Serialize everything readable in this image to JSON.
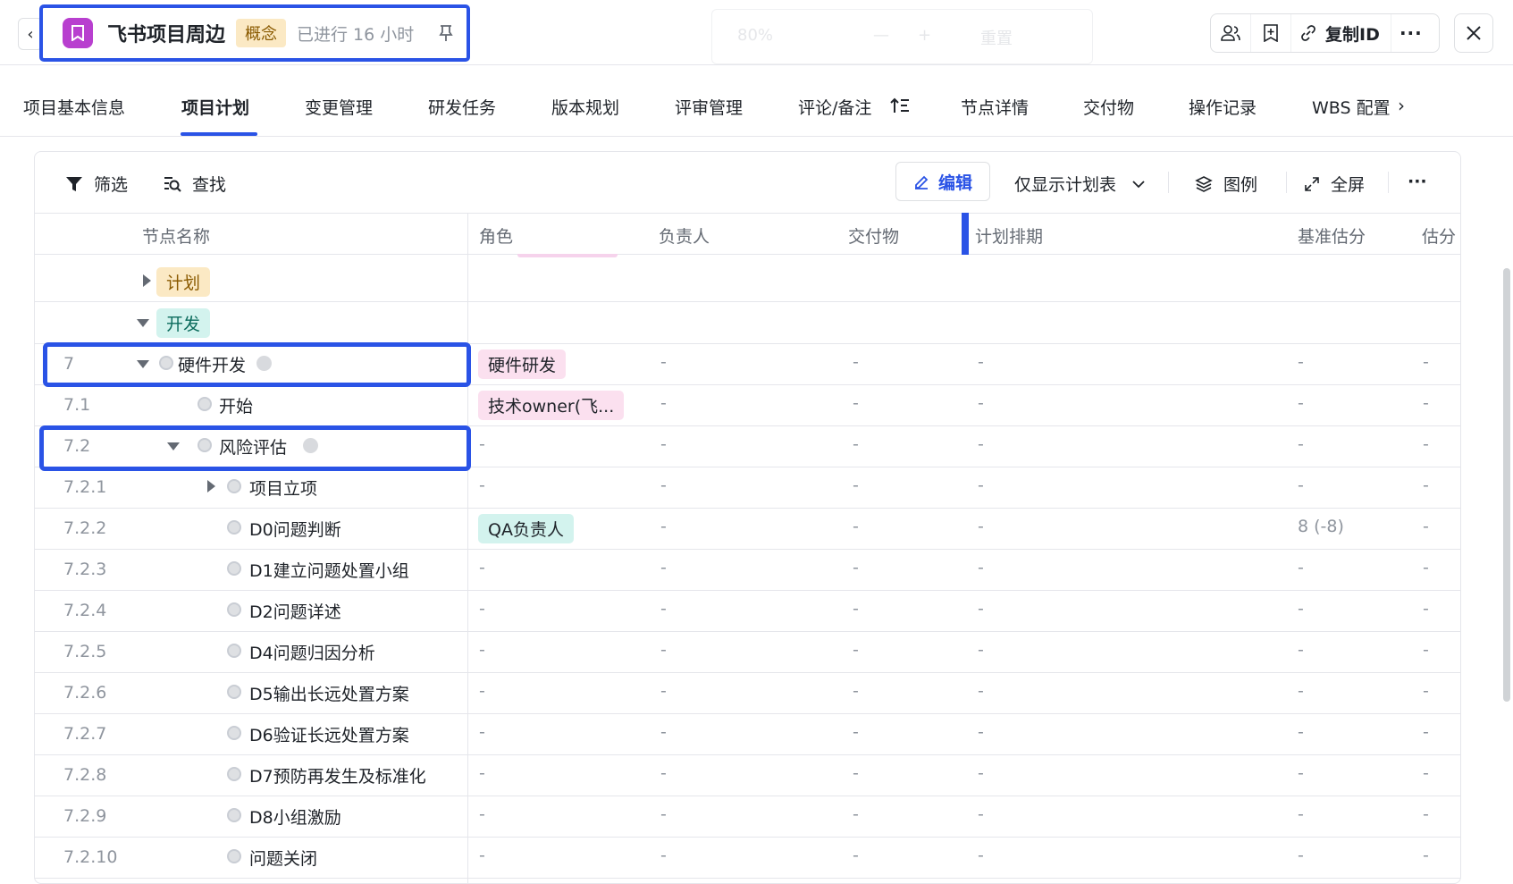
{
  "header": {
    "back_label": "‹",
    "project_title": "飞书项目周边",
    "stage": "概念",
    "elapsed": "已进行 16 小时",
    "ghost_zoom": "80%",
    "ghost_reset": "重置",
    "copy_id": "复制ID",
    "more": "···",
    "close": "✕"
  },
  "tabs": [
    {
      "label": "项目基本信息"
    },
    {
      "label": "项目计划",
      "active": true
    },
    {
      "label": "变更管理"
    },
    {
      "label": "研发任务"
    },
    {
      "label": "版本规划"
    },
    {
      "label": "评审管理"
    },
    {
      "label": "评论/备注"
    },
    {
      "label": "节点详情"
    },
    {
      "label": "交付物"
    },
    {
      "label": "操作记录"
    },
    {
      "label": "WBS 配置"
    }
  ],
  "tab_more": "›",
  "toolbar": {
    "filter": "筛选",
    "find": "查找",
    "edit": "编辑",
    "view_mode": "仅显示计划表",
    "legend": "图例",
    "fullscreen": "全屏",
    "more": "···"
  },
  "columns": {
    "node_name": "节点名称",
    "role": "角色",
    "owner": "负责人",
    "deliverable": "交付物",
    "schedule": "计划排期",
    "baseline_score": "基准估分",
    "score": "估分"
  },
  "groups": {
    "plan": "计划",
    "dev": "开发"
  },
  "rows": [
    {
      "num": "7",
      "name": "硬件开发",
      "role": "硬件研发",
      "owner": "-",
      "deliverable": "-",
      "schedule": "-",
      "baseline": "-",
      "score": "-"
    },
    {
      "num": "7.1",
      "name": "开始",
      "role": "技术owner(飞...",
      "owner": "-",
      "deliverable": "-",
      "schedule": "-",
      "baseline": "-",
      "score": "-"
    },
    {
      "num": "7.2",
      "name": "风险评估",
      "role": "-",
      "owner": "-",
      "deliverable": "-",
      "schedule": "-",
      "baseline": "-",
      "score": "-"
    },
    {
      "num": "7.2.1",
      "name": "项目立项",
      "role": "-",
      "owner": "-",
      "deliverable": "-",
      "schedule": "-",
      "baseline": "-",
      "score": "-"
    },
    {
      "num": "7.2.2",
      "name": "D0问题判断",
      "role": "QA负责人",
      "owner": "-",
      "deliverable": "-",
      "schedule": "-",
      "baseline": "8 (-8)",
      "score": "-"
    },
    {
      "num": "7.2.3",
      "name": "D1建立问题处置小组",
      "role": "-",
      "owner": "-",
      "deliverable": "-",
      "schedule": "-",
      "baseline": "-",
      "score": "-"
    },
    {
      "num": "7.2.4",
      "name": "D2问题详述",
      "role": "-",
      "owner": "-",
      "deliverable": "-",
      "schedule": "-",
      "baseline": "-",
      "score": "-"
    },
    {
      "num": "7.2.5",
      "name": "D4问题归因分析",
      "role": "-",
      "owner": "-",
      "deliverable": "-",
      "schedule": "-",
      "baseline": "-",
      "score": "-"
    },
    {
      "num": "7.2.6",
      "name": "D5输出长远处置方案",
      "role": "-",
      "owner": "-",
      "deliverable": "-",
      "schedule": "-",
      "baseline": "-",
      "score": "-"
    },
    {
      "num": "7.2.7",
      "name": "D6验证长远处置方案",
      "role": "-",
      "owner": "-",
      "deliverable": "-",
      "schedule": "-",
      "baseline": "-",
      "score": "-"
    },
    {
      "num": "7.2.8",
      "name": "D7预防再发生及标准化",
      "role": "-",
      "owner": "-",
      "deliverable": "-",
      "schedule": "-",
      "baseline": "-",
      "score": "-"
    },
    {
      "num": "7.2.9",
      "name": "D8小组激励",
      "role": "-",
      "owner": "-",
      "deliverable": "-",
      "schedule": "-",
      "baseline": "-",
      "score": "-"
    },
    {
      "num": "7.2.10",
      "name": "问题关闭",
      "role": "-",
      "owner": "-",
      "deliverable": "-",
      "schedule": "-",
      "baseline": "-",
      "score": "-"
    }
  ],
  "colors": {
    "accent": "#2a53e6",
    "project_icon": "#b83fcf",
    "stage_badge_bg": "#fbe9c4",
    "tag_plan_bg": "#fbe9c4",
    "tag_dev_bg": "#d3f3ee",
    "role_hardware_bg": "#fbe0ef",
    "role_tech_owner_bg": "#fbe0ef",
    "role_qa_bg": "#d3f3ee"
  },
  "icons": [
    "chevron-left-icon",
    "bookmark-icon",
    "pin-icon",
    "members-icon",
    "add-bookmark-icon",
    "link-icon",
    "more-icon",
    "close-icon",
    "sort-icon",
    "chevron-right-icon",
    "filter-icon",
    "find-icon",
    "edit-icon",
    "chevron-down-icon",
    "layers-icon",
    "expand-icon"
  ]
}
